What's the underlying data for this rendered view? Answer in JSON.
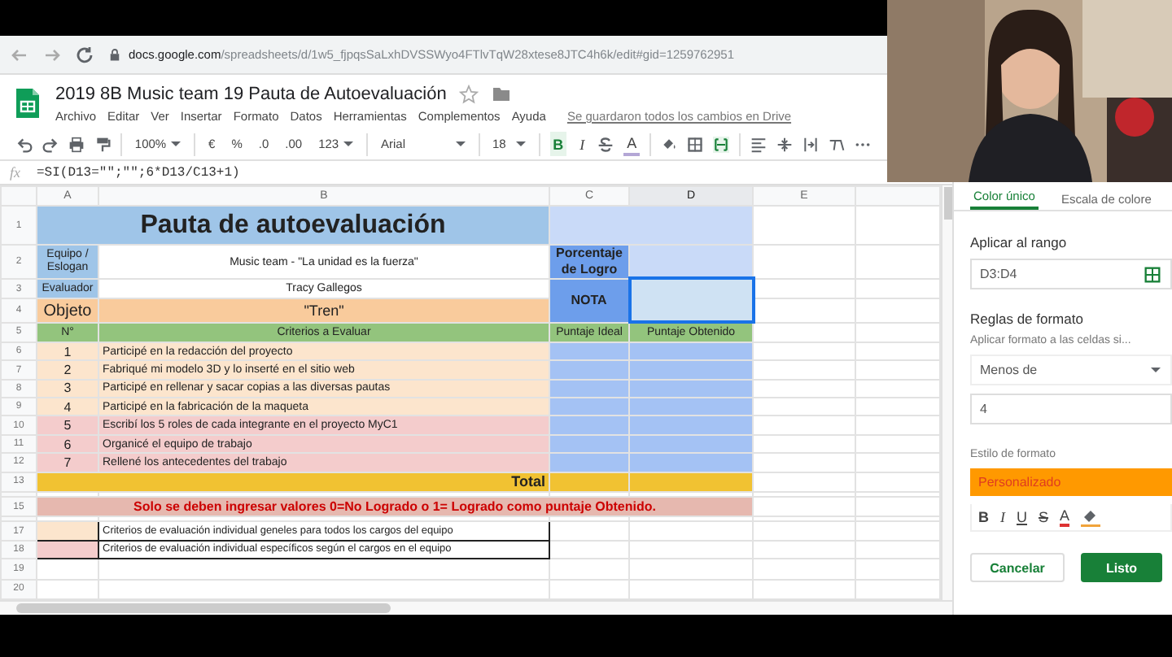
{
  "browser": {
    "url_host": "docs.google.com",
    "url_path": "/spreadsheets/d/1w5_fjpqsSaLxhDVSSWyo4FTlvTqW28xtese8JTC4h6k/edit#gid=1259762951"
  },
  "document": {
    "title": "2019 8B Music team 19 Pauta de Autoevaluación",
    "menu": [
      "Archivo",
      "Editar",
      "Ver",
      "Insertar",
      "Formato",
      "Datos",
      "Herramientas",
      "Complementos",
      "Ayuda"
    ],
    "save_status": "Se guardaron todos los cambios en Drive"
  },
  "toolbar": {
    "zoom": "100%",
    "currency": "€",
    "percent": "%",
    "decimal_less": ".0",
    "decimal_more": ".00",
    "number_format": "123",
    "font": "Arial",
    "font_size": "18",
    "styles": [
      {
        "label": "B",
        "selected": true
      },
      {
        "label": "I",
        "selected": false
      },
      {
        "label": "A",
        "selected": false
      }
    ],
    "merge_selected": true
  },
  "formula_bar": {
    "label": "fx",
    "formula": "=SI(D13=\"\";\"\";6*D13/C13+1)"
  },
  "columns": [
    {
      "label": "A",
      "selected": false
    },
    {
      "label": "B",
      "selected": false
    },
    {
      "label": "C",
      "selected": false
    },
    {
      "label": "D",
      "selected": true
    },
    {
      "label": "E",
      "selected": false
    }
  ],
  "rows": [
    {
      "number": "1",
      "kind": "title",
      "text": "Pauta de autoevaluación"
    },
    {
      "number": "2",
      "kind": "info",
      "label": "Equipo / Eslogan",
      "value": "Music team - \"La unidad es la fuerza\"",
      "side": "Porcentaje de Logro"
    },
    {
      "number": "3",
      "kind": "info",
      "label": "Evaluador",
      "value": "Tracy Gallegos",
      "side": "NOTA",
      "selected": true
    },
    {
      "number": "4",
      "kind": "object",
      "label": "Objeto",
      "value": "\"Tren\""
    },
    {
      "number": "5",
      "kind": "header",
      "cells": [
        "N°",
        "Criterios a Evaluar",
        "Puntaje Ideal",
        "Puntaje Obtenido"
      ]
    },
    {
      "number": "6",
      "kind": "criterion",
      "n": "1",
      "text": "Participé en la redacción del proyecto",
      "color": "#fce5cd"
    },
    {
      "number": "7",
      "kind": "criterion",
      "n": "2",
      "text": "Fabriqué mi modelo 3D y lo inserté en el sitio  web",
      "color": "#fce5cd"
    },
    {
      "number": "8",
      "kind": "criterion",
      "n": "3",
      "text": "Participé en rellenar y sacar copias a las diversas pautas",
      "color": "#fce5cd"
    },
    {
      "number": "9",
      "kind": "criterion",
      "n": "4",
      "text": "Participé en la fabricación de la maqueta",
      "color": "#fce5cd"
    },
    {
      "number": "10",
      "kind": "criterion",
      "n": "5",
      "text": "Escribí los 5 roles de cada integrante en el proyecto MyC1",
      "color": "#f4cccc"
    },
    {
      "number": "11",
      "kind": "criterion",
      "n": "6",
      "text": "Organicé el equipo de trabajo",
      "color": "#f4cccc"
    },
    {
      "number": "12",
      "kind": "criterion",
      "n": "7",
      "text": "Rellené los antecedentes del trabajo",
      "color": "#f4cccc"
    },
    {
      "number": "13",
      "kind": "total",
      "text": "Total"
    },
    {
      "kind": "spacer"
    },
    {
      "number": "15",
      "kind": "note",
      "text": "Solo se deben ingresar valores 0=No Logrado o 1= Logrado como puntaje Obtenido."
    },
    {
      "kind": "spacer"
    },
    {
      "number": "17",
      "kind": "legend",
      "text": "Criterios de evaluación individual geneles para todos los cargos del equipo",
      "color": "#fce5cd"
    },
    {
      "number": "18",
      "kind": "legend",
      "text": "Criterios de evaluación individual específicos según el cargos en el equipo",
      "color": "#f4cccc"
    },
    {
      "number": "19",
      "kind": "empty"
    },
    {
      "number": "20",
      "kind": "empty"
    }
  ],
  "side_panel": {
    "tabs": [
      {
        "label": "Color único",
        "selected": true
      },
      {
        "label": "Escala de colore",
        "selected": false
      }
    ],
    "range_label": "Aplicar al rango",
    "range": "D3:D4",
    "rules_label": "Reglas de formato",
    "condition_label": "Aplicar formato a las celdas si...",
    "condition": "Menos de",
    "value": "4",
    "style_label": "Estilo de formato",
    "style_preview": "Personalizado",
    "style_buttons": [
      {
        "label": "B"
      },
      {
        "label": "I"
      },
      {
        "label": "U"
      },
      {
        "label": "S"
      },
      {
        "label": "A"
      }
    ],
    "cancel": "Cancelar",
    "done": "Listo"
  }
}
